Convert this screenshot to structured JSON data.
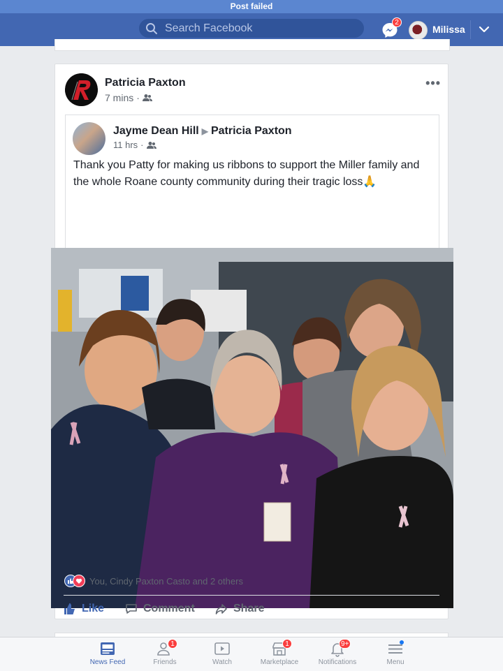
{
  "status_bar": {
    "message": "Post failed"
  },
  "topbar": {
    "search_placeholder": "Search Facebook",
    "messenger_badge": "2",
    "profile_name": "Milissa"
  },
  "post": {
    "author": "Patricia Paxton",
    "time": "7 mins",
    "dot": "·",
    "shared": {
      "author": "Jayme Dean Hill",
      "arrow": "▶",
      "target": "Patricia Paxton",
      "time": "11 hrs",
      "dot": "·",
      "text": "Thank you Patty for making us ribbons to support the Miller family and the whole Roane county community during their tragic loss🙏"
    },
    "reactions_text": "You, Cindy Paxton Casto and 2 others",
    "actions": {
      "like": "Like",
      "comment": "Comment",
      "share": "Share"
    }
  },
  "tabbar": {
    "tabs": [
      {
        "label": "News Feed",
        "icon": "news-feed-icon",
        "badge": "",
        "active": true
      },
      {
        "label": "Friends",
        "icon": "friends-icon",
        "badge": "1",
        "active": false
      },
      {
        "label": "Watch",
        "icon": "watch-icon",
        "badge": "",
        "active": false
      },
      {
        "label": "Marketplace",
        "icon": "marketplace-icon",
        "badge": "1",
        "active": false
      },
      {
        "label": "Notifications",
        "icon": "bell-icon",
        "badge": "9+",
        "active": false
      },
      {
        "label": "Menu",
        "icon": "menu-icon",
        "badge": "",
        "active": false
      }
    ]
  },
  "colors": {
    "brand": "#4267b2",
    "status_bar": "#5b86d0",
    "badge": "#fa3e3e",
    "love": "#f33e58"
  }
}
